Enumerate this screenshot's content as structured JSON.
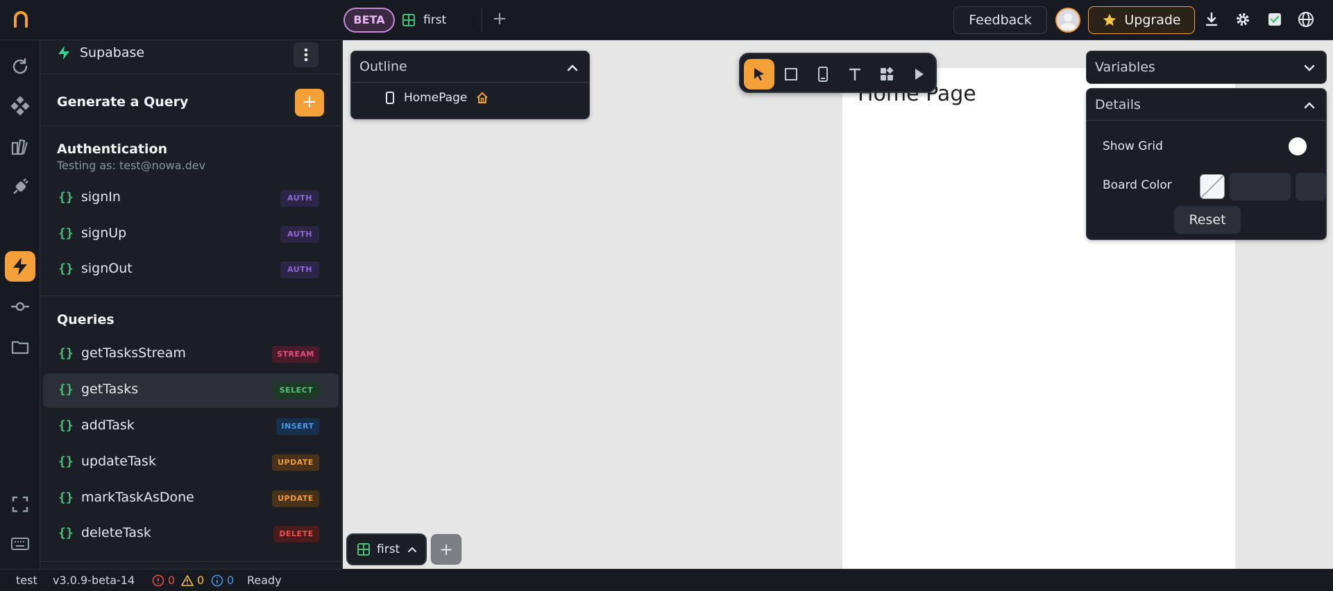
{
  "topbar": {
    "beta_label": "BETA",
    "tab_label": "first",
    "feedback_label": "Feedback",
    "upgrade_label": "Upgrade",
    "accent_color": "#f4a13a"
  },
  "rail": {
    "icons": [
      "refresh-icon",
      "components-icon",
      "assets-icon",
      "plug-icon",
      "lightning-icon",
      "commit-icon",
      "folder-icon",
      "fullscreen-icon",
      "keyboard-icon"
    ],
    "active": "lightning-icon"
  },
  "panel": {
    "source_name": "Supabase",
    "generate_label": "Generate a Query",
    "auth": {
      "title": "Authentication",
      "subtitle": "Testing as: test@nowa.dev",
      "items": [
        {
          "name": "signIn",
          "badge": "AUTH"
        },
        {
          "name": "signUp",
          "badge": "AUTH"
        },
        {
          "name": "signOut",
          "badge": "AUTH"
        }
      ]
    },
    "queries": {
      "title": "Queries",
      "items": [
        {
          "name": "getTasksStream",
          "badge": "STREAM"
        },
        {
          "name": "getTasks",
          "badge": "SELECT"
        },
        {
          "name": "addTask",
          "badge": "INSERT"
        },
        {
          "name": "updateTask",
          "badge": "UPDATE"
        },
        {
          "name": "markTaskAsDone",
          "badge": "UPDATE"
        },
        {
          "name": "deleteTask",
          "badge": "DELETE"
        }
      ],
      "selected_index": 1
    }
  },
  "canvas": {
    "outline_title": "Outline",
    "outline_item": "HomePage",
    "board_title": "Home Page",
    "variables_title": "Variables",
    "details_title": "Details",
    "show_grid_label": "Show Grid",
    "board_color_label": "Board Color",
    "reset_label": "Reset",
    "page_tab_label": "first",
    "show_grid_on": false
  },
  "statusbar": {
    "project": "test",
    "version": "v3.0.9-beta-14",
    "errors": "0",
    "warnings": "0",
    "infos": "0",
    "status": "Ready"
  }
}
